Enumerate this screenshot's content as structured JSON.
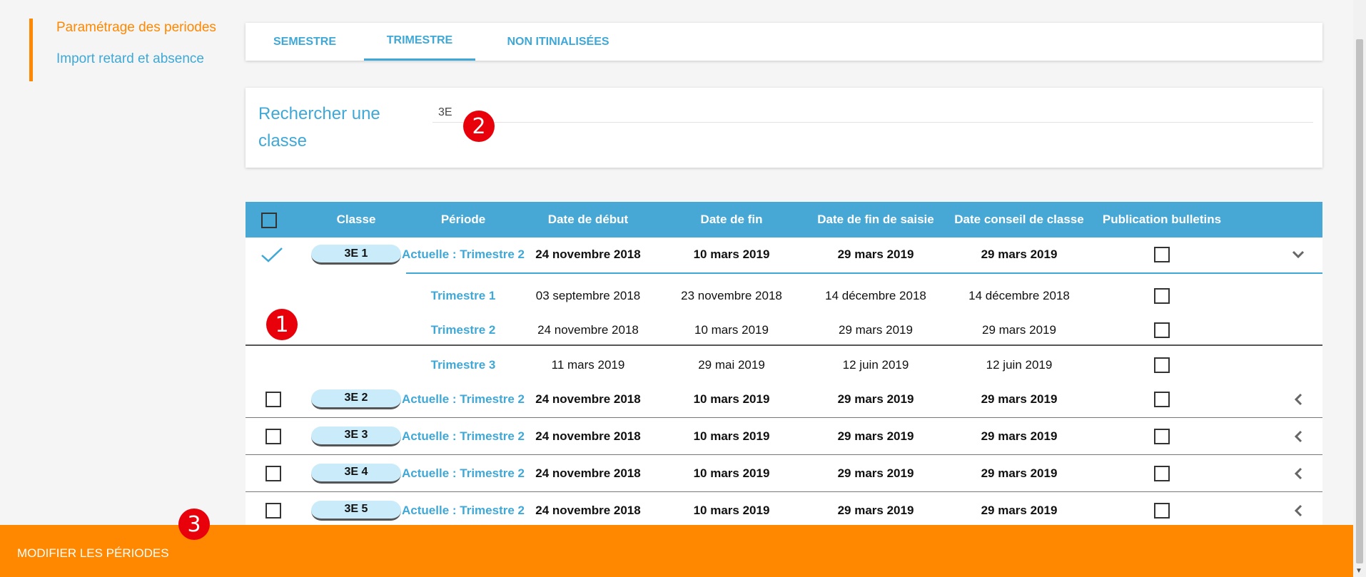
{
  "sidebar": {
    "items": [
      {
        "label": "Paramétrage des periodes"
      },
      {
        "label": "Import retard et absence"
      }
    ]
  },
  "tabs": [
    {
      "label": "SEMESTRE"
    },
    {
      "label": "TRIMESTRE"
    },
    {
      "label": "NON ITINIALISÉES"
    }
  ],
  "search": {
    "label": "Rechercher une classe",
    "value": "3E"
  },
  "table": {
    "headers": {
      "classe": "Classe",
      "periode": "Période",
      "debut": "Date de début",
      "fin": "Date de fin",
      "fin_saisie": "Date de fin de saisie",
      "conseil": "Date conseil de classe",
      "publication": "Publication bulletins"
    },
    "expanded_row": {
      "classe": "3E 1",
      "periode": "Actuelle : Trimestre 2",
      "debut": "24 novembre 2018",
      "fin": "10 mars 2019",
      "fin_saisie": "29 mars 2019",
      "conseil": "29 mars 2019",
      "sub_rows": [
        {
          "periode": "Trimestre 1",
          "debut": "03 septembre 2018",
          "fin": "23 novembre 2018",
          "fin_saisie": "14 décembre 2018",
          "conseil": "14 décembre 2018"
        },
        {
          "periode": "Trimestre 2",
          "debut": "24 novembre 2018",
          "fin": "10 mars 2019",
          "fin_saisie": "29 mars 2019",
          "conseil": "29 mars 2019"
        },
        {
          "periode": "Trimestre 3",
          "debut": "11 mars 2019",
          "fin": "29 mai 2019",
          "fin_saisie": "12 juin 2019",
          "conseil": "12 juin 2019"
        }
      ]
    },
    "rows": [
      {
        "classe": "3E 2",
        "periode": "Actuelle : Trimestre 2",
        "debut": "24 novembre 2018",
        "fin": "10 mars 2019",
        "fin_saisie": "29 mars 2019",
        "conseil": "29 mars 2019"
      },
      {
        "classe": "3E 3",
        "periode": "Actuelle : Trimestre 2",
        "debut": "24 novembre 2018",
        "fin": "10 mars 2019",
        "fin_saisie": "29 mars 2019",
        "conseil": "29 mars 2019"
      },
      {
        "classe": "3E 4",
        "periode": "Actuelle : Trimestre 2",
        "debut": "24 novembre 2018",
        "fin": "10 mars 2019",
        "fin_saisie": "29 mars 2019",
        "conseil": "29 mars 2019"
      },
      {
        "classe": "3E 5",
        "periode": "Actuelle : Trimestre 2",
        "debut": "24 novembre 2018",
        "fin": "10 mars 2019",
        "fin_saisie": "29 mars 2019",
        "conseil": "29 mars 2019"
      }
    ]
  },
  "annotations": {
    "one": "1",
    "two": "2",
    "three": "3"
  },
  "bottom_bar": {
    "button_label": "MODIFIER LES PÉRIODES"
  },
  "colors": {
    "accent": "#ff8800",
    "primary": "#47a8d6",
    "link": "#3fa8d6",
    "marker": "#e8000b"
  },
  "icons": [
    "check-icon",
    "chevron-down-icon",
    "chevron-left-icon",
    "scroll-down-arrow-icon"
  ]
}
